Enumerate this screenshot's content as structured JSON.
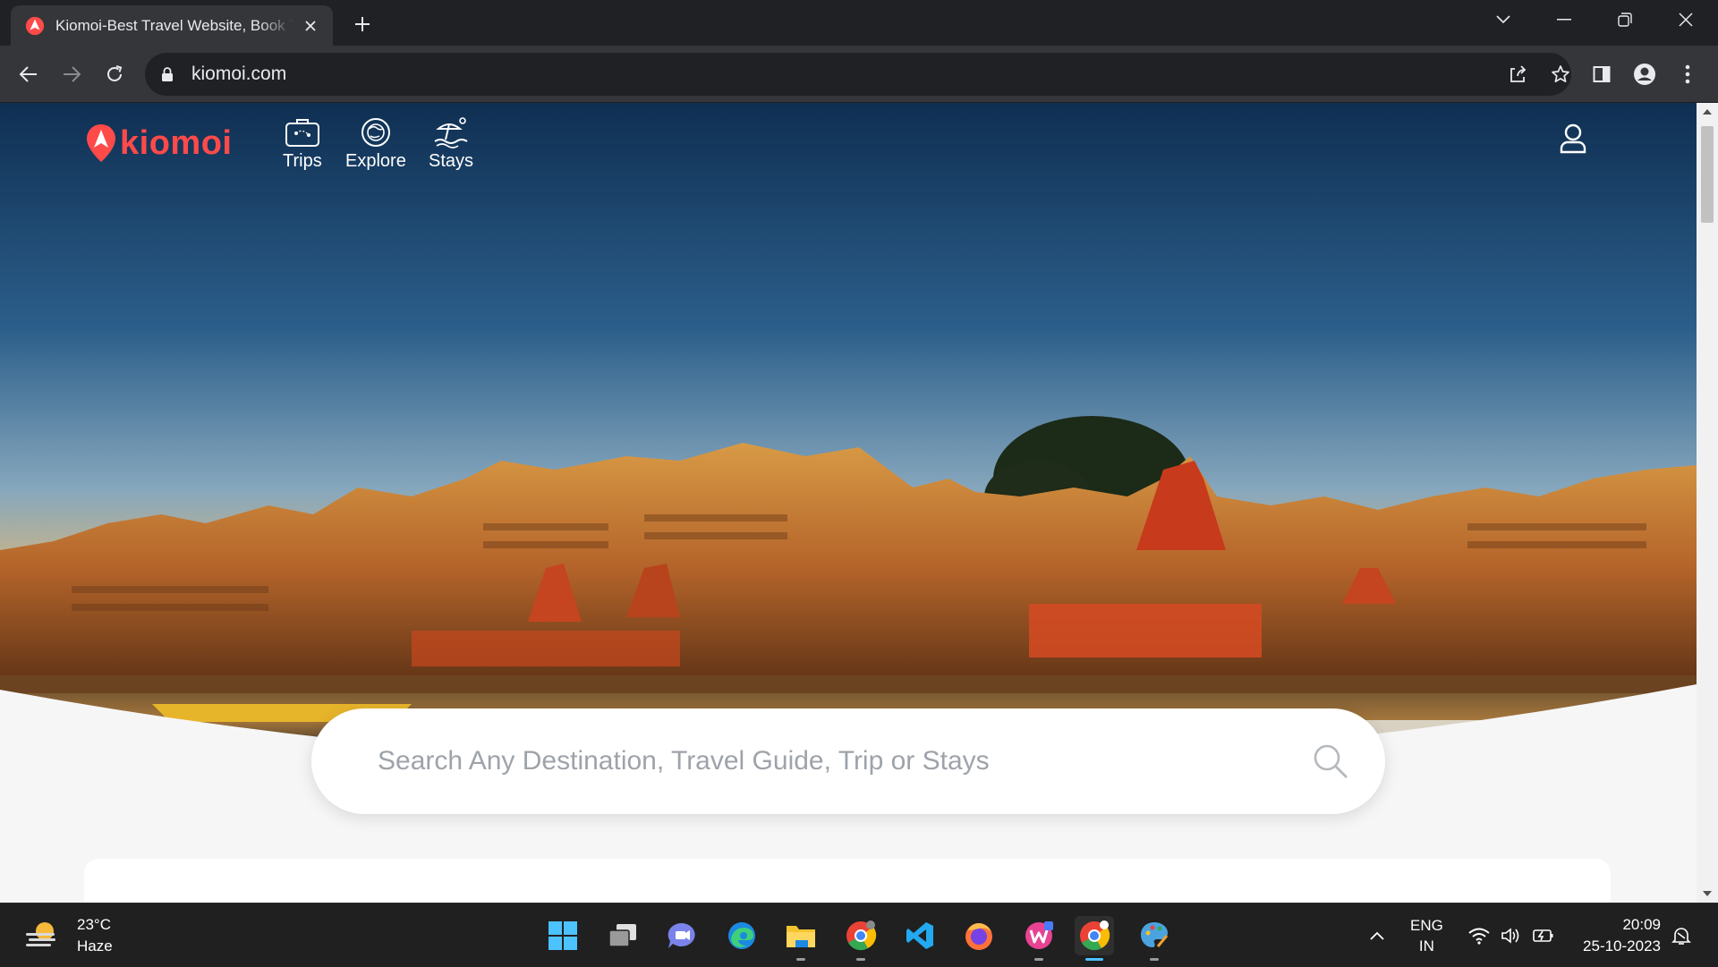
{
  "browser": {
    "tab_title": "Kiomoi-Best Travel Website, Book Trips, Stays",
    "url": "kiomoi.com"
  },
  "site": {
    "brand": "kiomoi",
    "brand_color": "#ff4a4a",
    "nav": [
      {
        "label": "Trips",
        "icon": "suitcase-icon"
      },
      {
        "label": "Explore",
        "icon": "globe-icon"
      },
      {
        "label": "Stays",
        "icon": "beach-icon"
      }
    ],
    "search_placeholder": "Search Any Destination, Travel Guide, Trip or Stays"
  },
  "taskbar": {
    "temperature": "23°C",
    "condition": "Haze",
    "lang_primary": "ENG",
    "lang_secondary": "IN",
    "time": "20:09",
    "date": "25-10-2023"
  }
}
